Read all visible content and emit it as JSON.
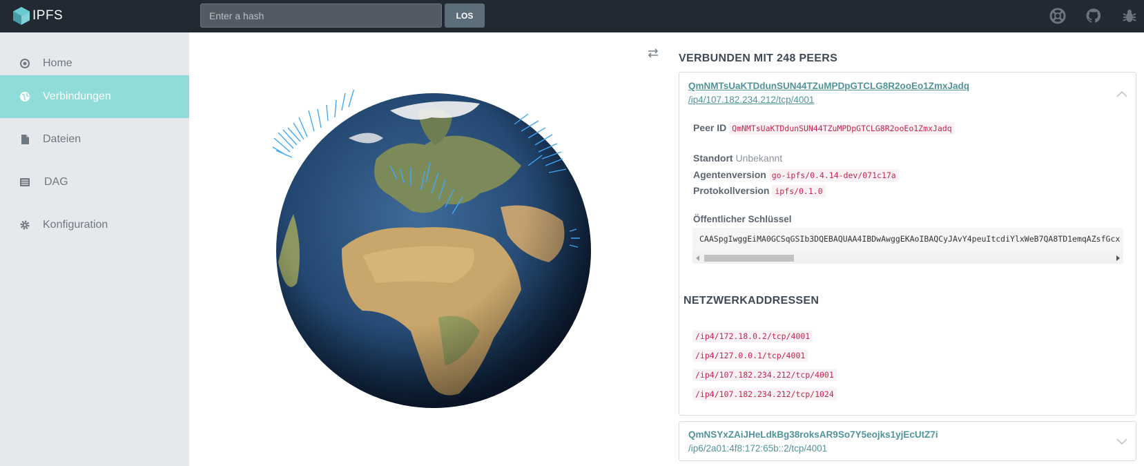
{
  "app": {
    "name": "IPFS"
  },
  "search": {
    "placeholder": "Enter a hash",
    "button_label": "LOS"
  },
  "topbar_icons": [
    "lifebuoy-icon",
    "github-icon",
    "bug-icon"
  ],
  "sidebar": {
    "items": [
      {
        "label": "Home",
        "icon": "target-icon",
        "active": false
      },
      {
        "label": "Verbindungen",
        "icon": "globe-icon",
        "active": true
      },
      {
        "label": "Dateien",
        "icon": "file-icon",
        "active": false
      },
      {
        "label": "DAG",
        "icon": "list-icon",
        "active": false
      },
      {
        "label": "Konfiguration",
        "icon": "gear-icon",
        "active": false
      }
    ]
  },
  "connections": {
    "title": "VERBUNDEN MIT 248 PEERS",
    "peers": [
      {
        "id": "QmNMTsUaKTDdunSUN44TZuMPDpGTCLG8R2ooEo1ZmxJadq",
        "address": "/ip4/107.182.234.212/tcp/4001",
        "expanded": true,
        "details": {
          "peer_id_label": "Peer ID",
          "peer_id": "QmNMTsUaKTDdunSUN44TZuMPDpGTCLG8R2ooEo1ZmxJadq",
          "location_label": "Standort",
          "location": "Unbekannt",
          "agent_label": "Agentenversion",
          "agent": "go-ipfs/0.4.14-dev/071c17a",
          "protocol_label": "Protokollversion",
          "protocol": "ipfs/0.1.0",
          "pubkey_label": "Öffentlicher Schlüssel",
          "pubkey": "CAASpgIwggEiMA0GCSqGSIb3DQEBAQUAA4IBDwAwggEKAoIBAQCyJAvY4peuItcdiYlxWeB7QA8TD1emqAZsfGcx",
          "network_title": "NETZWERKADDRESSEN",
          "addresses": [
            "/ip4/172.18.0.2/tcp/4001",
            "/ip4/127.0.0.1/tcp/4001",
            "/ip4/107.182.234.212/tcp/4001",
            "/ip4/107.182.234.212/tcp/1024"
          ]
        }
      },
      {
        "id": "QmNSYxZAiJHeLdkBg38roksAR9So7Y5eojks1yjEcUtZ7i",
        "address": "/ip6/2a01:4f8:172:65b::2/tcp/4001",
        "expanded": false
      }
    ]
  },
  "colors": {
    "topbar": "#212a33",
    "sidebar": "#e6e9ec",
    "active": "#8fdcd8",
    "link": "#50949a",
    "code": "#c7254e"
  }
}
